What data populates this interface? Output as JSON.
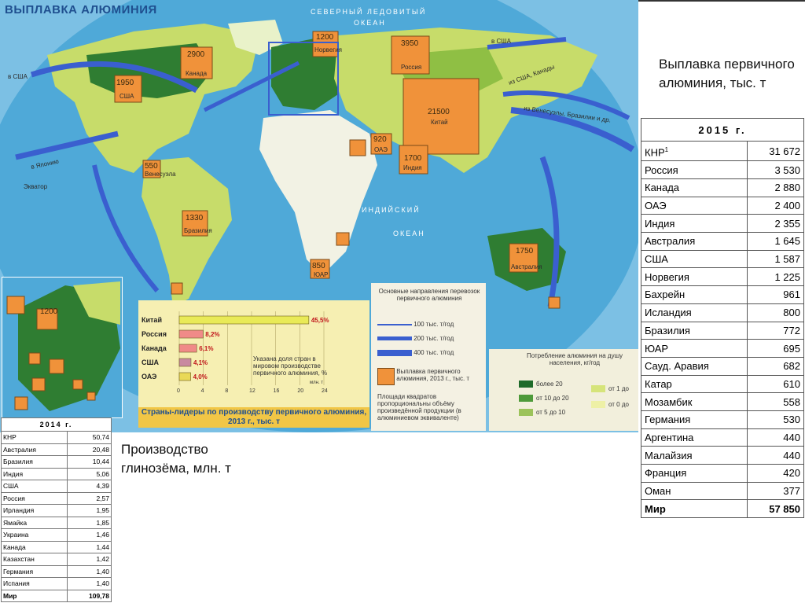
{
  "colors": {
    "ocean": "#4fa9d8",
    "land": "#c7dc6a",
    "dark_green": "#2f7d32",
    "orange": "#f0923a",
    "bar_yellow": "#e9ea57",
    "bar_pink": "#f08a88",
    "arrow_blue": "#3a5fcf"
  },
  "map": {
    "title": "ВЫПЛАВКА АЛЮМИНИЯ",
    "ocean_labels": [
      "СЕВЕРНЫЙ ЛЕДОВИТЫЙ",
      "ОКЕАН",
      "ИНДИЙСКИЙ",
      "ОКЕАН",
      "Экватор"
    ],
    "arrow_labels": [
      "в США",
      "из США, Канады",
      "из Венесуэлы, Бразилии и др.",
      "в Японию",
      "в США"
    ],
    "smelting": [
      {
        "country": "Норвегия",
        "value": "1200"
      },
      {
        "country": "Канада",
        "value": "2900"
      },
      {
        "country": "США",
        "value": "1950"
      },
      {
        "country": "Россия",
        "value": "3950"
      },
      {
        "country": "Китай",
        "value": "21500"
      },
      {
        "country": "ОАЭ",
        "value": "920"
      },
      {
        "country": "Индия",
        "value": "1700"
      },
      {
        "country": "Венесуэла",
        "value": "550"
      },
      {
        "country": "Бразилия",
        "value": "1330"
      },
      {
        "country": "ЮАР",
        "value": "850"
      },
      {
        "country": "Австралия",
        "value": "1750"
      }
    ],
    "inset_value": "1200"
  },
  "bar_chart": {
    "title": "Страны-лидеры по производству первичного алюминия, 2013 г., тыс. т",
    "note": "Указана доля стран в мировом производстве первичного алюминия, %",
    "unit": "млн. т",
    "ticks": [
      "0",
      "4",
      "8",
      "12",
      "16",
      "20",
      "24"
    ],
    "bars": [
      {
        "label": "Китай",
        "value": 21.5,
        "pct": "45,5%"
      },
      {
        "label": "Россия",
        "value": 3.95,
        "pct": "8,2%"
      },
      {
        "label": "Канада",
        "value": 2.9,
        "pct": "6,1%"
      },
      {
        "label": "США",
        "value": 1.95,
        "pct": "4,1%"
      },
      {
        "label": "ОАЭ",
        "value": 1.9,
        "pct": "4,0%"
      }
    ],
    "xlim": [
      0,
      24
    ]
  },
  "legend": {
    "title": "Основные направления перевозок первичного алюминия",
    "arrows": [
      "100 тыс. т/год",
      "200 тыс. т/год",
      "400 тыс. т/год"
    ],
    "square": "Выплавка первичного алюминия, 2013 г., тыс. т",
    "note": "Площади квадратов пропорциональны объёму произведённой продукции (в алюминиевом эквиваленте)"
  },
  "consumption": {
    "title": "Потребление алюминия на душу населения, кг/год",
    "items": [
      "более 20",
      "от 10 до 20",
      "от 5 до 10",
      "от 1 до",
      "от 0 до"
    ]
  },
  "caption_right": "Выплавка первичного алюминия, тыс. т",
  "caption_mid": "Производство глинозёма, млн. т",
  "table2015": {
    "header": "2015 г.",
    "rows": [
      [
        "КНР",
        "31 672"
      ],
      [
        "Россия",
        "3 530"
      ],
      [
        "Канада",
        "2 880"
      ],
      [
        "ОАЭ",
        "2 400"
      ],
      [
        "Индия",
        "2 355"
      ],
      [
        "Австралия",
        "1 645"
      ],
      [
        "США",
        "1 587"
      ],
      [
        "Норвегия",
        "1 225"
      ],
      [
        "Бахрейн",
        "961"
      ],
      [
        "Исландия",
        "800"
      ],
      [
        "Бразилия",
        "772"
      ],
      [
        "ЮАР",
        "695"
      ],
      [
        "Сауд. Аравия",
        "682"
      ],
      [
        "Катар",
        "610"
      ],
      [
        "Мозамбик",
        "558"
      ],
      [
        "Германия",
        "530"
      ],
      [
        "Аргентина",
        "440"
      ],
      [
        "Малайзия",
        "440"
      ],
      [
        "Франция",
        "420"
      ],
      [
        "Оман",
        "377"
      ]
    ],
    "total": [
      "Мир",
      "57 850"
    ],
    "footnote_mark": "1"
  },
  "table2014": {
    "header": "2014 г.",
    "rows": [
      [
        "КНР",
        "50,74"
      ],
      [
        "Австралия",
        "20,48"
      ],
      [
        "Бразилия",
        "10,44"
      ],
      [
        "Индия",
        "5,06"
      ],
      [
        "США",
        "4,39"
      ],
      [
        "Россия",
        "2,57"
      ],
      [
        "Ирландия",
        "1,95"
      ],
      [
        "Ямайка",
        "1,85"
      ],
      [
        "Украина",
        "1,46"
      ],
      [
        "Канада",
        "1,44"
      ],
      [
        "Казахстан",
        "1,42"
      ],
      [
        "Германия",
        "1,40"
      ],
      [
        "Испания",
        "1,40"
      ]
    ],
    "total": [
      "Мир",
      "109,78"
    ]
  }
}
